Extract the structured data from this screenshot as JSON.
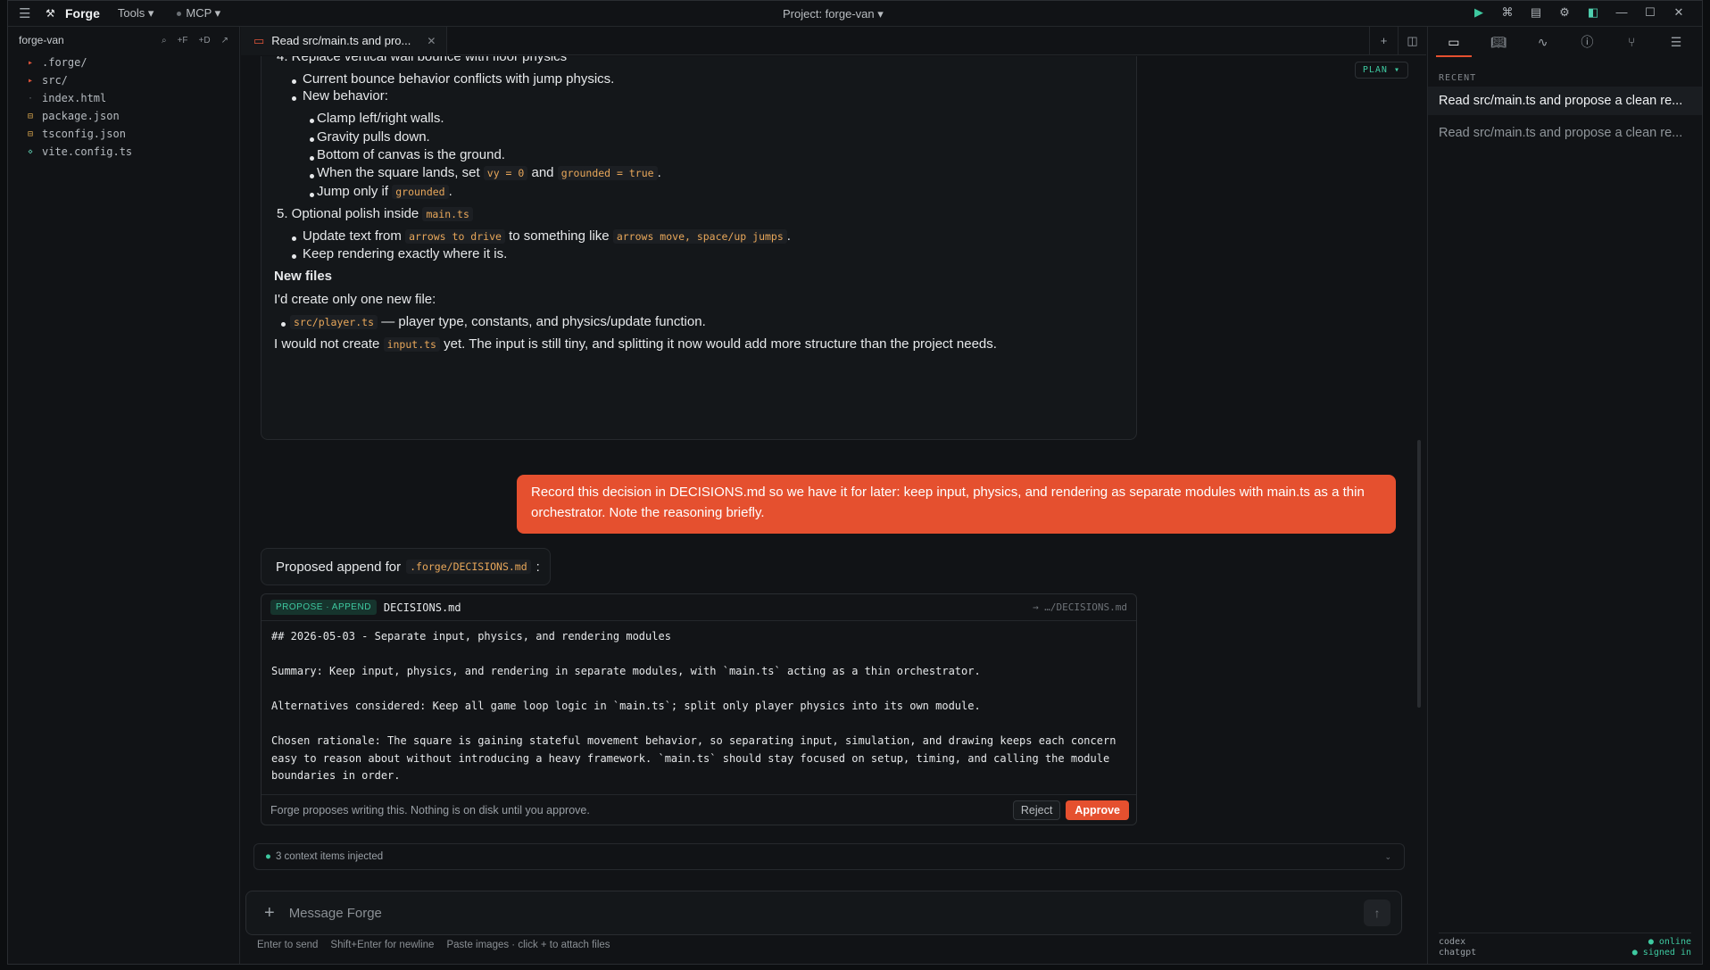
{
  "titlebar": {
    "app_name": "Forge",
    "tools_menu": "Tools ▾",
    "mcp_menu": "MCP ▾",
    "project": "Project: forge-van ▾"
  },
  "sidebar": {
    "workspace": "forge-van",
    "actions": [
      "⌕",
      "+F",
      "+D",
      "↗"
    ],
    "files": [
      {
        "name": ".forge/",
        "kind": "folder"
      },
      {
        "name": "src/",
        "kind": "folder"
      },
      {
        "name": "index.html",
        "kind": "file"
      },
      {
        "name": "package.json",
        "kind": "json"
      },
      {
        "name": "tsconfig.json",
        "kind": "json"
      },
      {
        "name": "vite.config.ts",
        "kind": "ts"
      }
    ]
  },
  "tab": {
    "label": "Read src/main.ts and pro..."
  },
  "main": {
    "mode": "PLAN ▾",
    "assistant": {
      "item4": "4. Replace vertical wall bounce with floor physics",
      "b1": "Current bounce behavior conflicts with jump physics.",
      "b2": "New behavior:",
      "s1": "Clamp left/right walls.",
      "s2": "Gravity pulls down.",
      "s3": "Bottom of canvas is the ground.",
      "s4a": "When the square lands, set",
      "s4c1": "vy = 0",
      "s4b": "and",
      "s4c2": "grounded = true",
      "s4d": ".",
      "s5a": "Jump only if",
      "s5c": "grounded",
      "s5d": ".",
      "item5a": "5. Optional polish inside",
      "item5c": "main.ts",
      "p1a": "Update text from",
      "p1c1": "arrows to drive",
      "p1b": "to something like",
      "p1c2": "arrows move, space/up jumps",
      "p1d": ".",
      "p2": "Keep rendering exactly where it is.",
      "new_files": "New files",
      "intro": "I'd create only one new file:",
      "f1c": "src/player.ts",
      "f1": "— player type, constants, and physics/update function.",
      "close_a": "I would not create",
      "close_c": "input.ts",
      "close_b": "yet. The input is still tiny, and splitting it now would add more structure than the project needs."
    },
    "user_message": "Record this decision in DECISIONS.md so we have it for later: keep input, physics, and rendering as separate modules with main.ts as a thin orchestrator. Note the reasoning briefly.",
    "proposed": {
      "prefix": "Proposed append for",
      "path": ".forge/DECISIONS.md",
      "suffix": ":"
    },
    "card": {
      "badge": "PROPOSE · APPEND",
      "filename": "DECISIONS.md",
      "target": "→ …/DECISIONS.md",
      "content": "## 2026-05-03 - Separate input, physics, and rendering modules\n\nSummary: Keep input, physics, and rendering in separate modules, with `main.ts` acting as a thin orchestrator.\n\nAlternatives considered: Keep all game loop logic in `main.ts`; split only player physics into its own module.\n\nChosen rationale: The square is gaining stateful movement behavior, so separating input, simulation, and drawing keeps each concern\neasy to reason about without introducing a heavy framework. `main.ts` should stay focused on setup, timing, and calling the module\nboundaries in order.",
      "footer": "Forge proposes writing this. Nothing is on disk until you approve.",
      "reject": "Reject",
      "approve": "Approve"
    },
    "context": "3 context items injected"
  },
  "composer": {
    "placeholder": "Message Forge",
    "hints": [
      "Enter to send",
      "Shift+Enter for newline",
      "Paste images · click + to attach files"
    ]
  },
  "rpanel": {
    "recent_label": "RECENT",
    "items": [
      "Read src/main.ts and propose a clean re...",
      "Read src/main.ts and propose a clean re..."
    ],
    "status": [
      {
        "name": "codex",
        "state": "● online"
      },
      {
        "name": "chatgpt",
        "state": "● signed in"
      }
    ]
  }
}
